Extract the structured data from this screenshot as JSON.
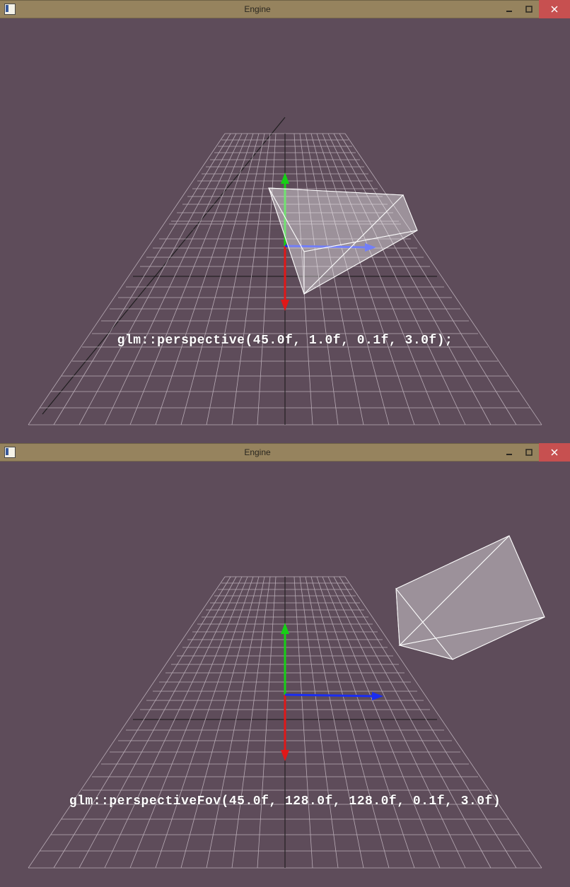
{
  "windows": [
    {
      "title": "Engine",
      "overlay": "glm::perspective(45.0f, 1.0f, 0.1f, 3.0f);"
    },
    {
      "title": "Engine",
      "overlay": "glm::perspectiveFov(45.0f, 128.0f, 128.0f, 0.1f, 3.0f)"
    }
  ]
}
